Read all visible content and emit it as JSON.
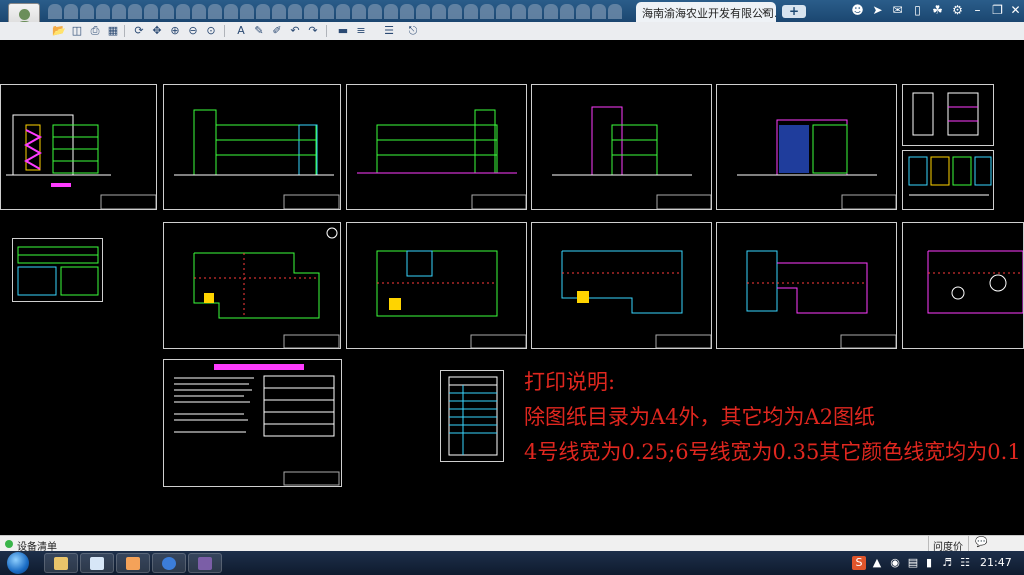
{
  "browser": {
    "active_tab_title": "海南渝海农业开发有限公司...",
    "close_glyph": "×",
    "new_tab_glyph": "+"
  },
  "toolbar": {
    "icons": [
      "open-icon",
      "save-icon",
      "print-icon",
      "pdf-icon",
      "rotate-icon",
      "zoom-in-icon",
      "zoom-out-icon",
      "zoom-fit-icon",
      "text-icon",
      "pen-icon",
      "marker-icon",
      "undo-icon",
      "redo-icon",
      "layer-icon",
      "linetype-icon",
      "layers-stack-icon",
      "export-icon"
    ]
  },
  "drawing": {
    "notes": {
      "title": "打印说明:",
      "line1": "除图纸目录为A4外，其它均为A2图纸",
      "line2": "4号线宽为0.25;6号线宽为0.35其它颜色线宽均为0.1"
    },
    "note_color": "#e0271f"
  },
  "statusbar": {
    "device_label": "设备清单",
    "help_label": "问度价",
    "help_glyph": "💬"
  },
  "taskbar": {
    "clock": "21:47"
  }
}
